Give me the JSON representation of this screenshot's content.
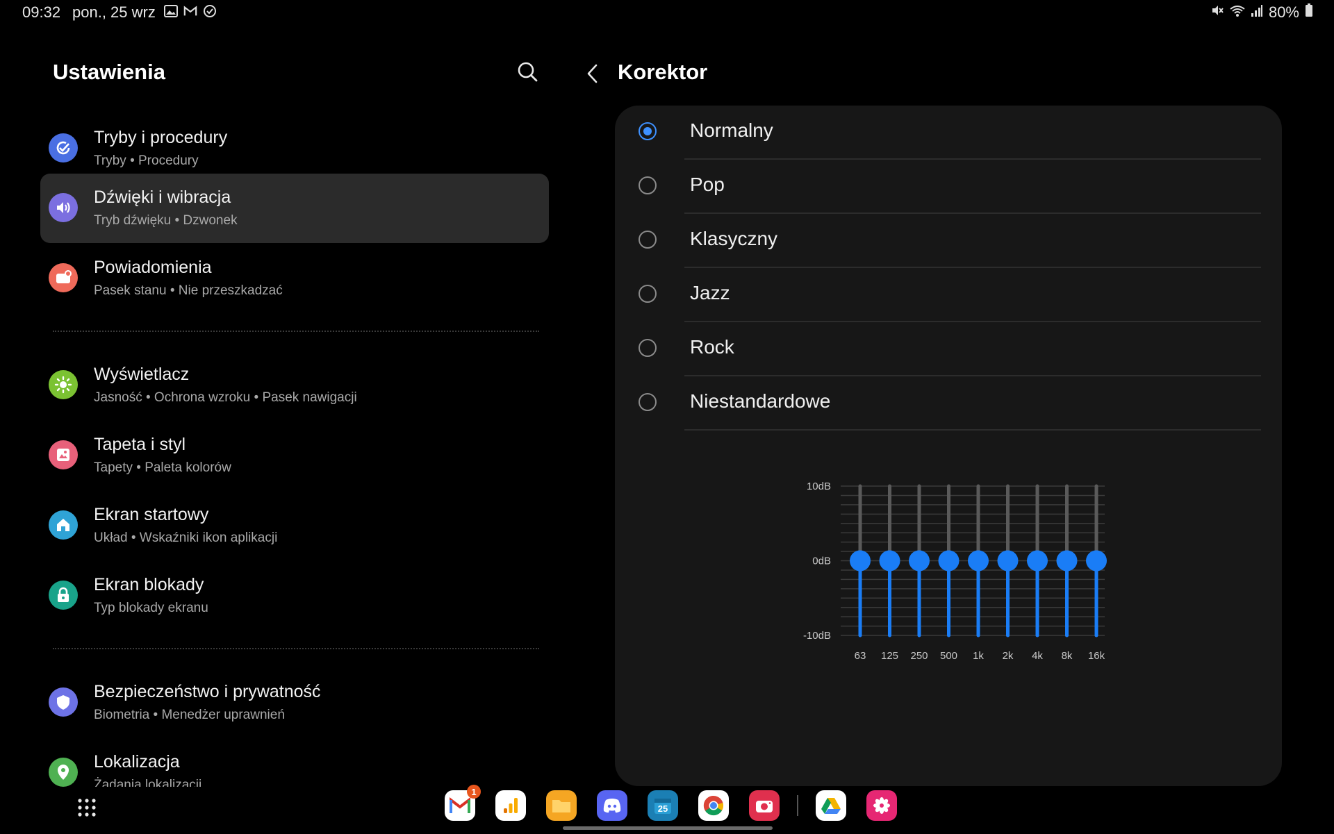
{
  "status_bar": {
    "time": "09:32",
    "date": "pon., 25 wrz",
    "notification_icons": [
      "image-icon",
      "gmail-icon",
      "sync-icon"
    ],
    "system_icons": [
      "mute-icon",
      "wifi-icon",
      "signal-icon",
      "battery-icon"
    ],
    "battery": "80%"
  },
  "settings": {
    "title": "Ustawienia",
    "items": [
      {
        "title": "Tryby i procedury",
        "subtitle": "Tryby  •  Procedury",
        "icon": "modes-icon",
        "color": "#4a6fe3"
      },
      {
        "title": "Dźwięki i wibracja",
        "subtitle": "Tryb dźwięku  •  Dzwonek",
        "icon": "sound-icon",
        "color": "#7b6fe0"
      },
      {
        "title": "Powiadomienia",
        "subtitle": "Pasek stanu  •  Nie przeszkadzać",
        "icon": "notification-icon",
        "color": "#ef6a5a"
      },
      {
        "title": "Wyświetlacz",
        "subtitle": "Jasność  •  Ochrona wzroku  •  Pasek nawigacji",
        "icon": "display-icon",
        "color": "#7bc232"
      },
      {
        "title": "Tapeta i styl",
        "subtitle": "Tapety  •  Paleta kolorów",
        "icon": "wallpaper-icon",
        "color": "#e8607a"
      },
      {
        "title": "Ekran startowy",
        "subtitle": "Układ  •  Wskaźniki ikon aplikacji",
        "icon": "home-icon",
        "color": "#2fa3d6"
      },
      {
        "title": "Ekran blokady",
        "subtitle": "Typ blokady ekranu",
        "icon": "lock-icon",
        "color": "#19a38a"
      },
      {
        "title": "Bezpieczeństwo i prywatność",
        "subtitle": "Biometria  •  Menedżer uprawnień",
        "icon": "shield-icon",
        "color": "#6d72e6"
      },
      {
        "title": "Lokalizacja",
        "subtitle": "Żądania lokalizacji",
        "icon": "location-icon",
        "color": "#4fb152"
      }
    ],
    "active_item": "Dźwięki i wibracja"
  },
  "equalizer": {
    "title": "Korektor",
    "presets": [
      "Normalny",
      "Pop",
      "Klasyczny",
      "Jazz",
      "Rock",
      "Niestandardowe"
    ],
    "selected": "Normalny",
    "accent": "#1a7df6",
    "y_labels": [
      "10dB",
      "0dB",
      "-10dB"
    ],
    "bands": [
      "63",
      "125",
      "250",
      "500",
      "1k",
      "2k",
      "4k",
      "8k",
      "16k"
    ],
    "levels_db": [
      0,
      0,
      0,
      0,
      0,
      0,
      0,
      0,
      0
    ],
    "range_db": [
      -10,
      10
    ]
  },
  "dock": {
    "apps": [
      {
        "name": "Gmail",
        "icon": "gmail-icon",
        "badge": "1"
      },
      {
        "name": "Analytics",
        "icon": "analytics-icon"
      },
      {
        "name": "Pliki",
        "icon": "folder-icon"
      },
      {
        "name": "Discord",
        "icon": "discord-icon"
      },
      {
        "name": "Kalendarz",
        "icon": "calendar-icon",
        "label": "25"
      },
      {
        "name": "Chrome",
        "icon": "chrome-icon"
      },
      {
        "name": "Aparat",
        "icon": "camera-icon"
      },
      {
        "name": "Dysk",
        "icon": "drive-icon"
      },
      {
        "name": "Bixby",
        "icon": "flower-icon"
      }
    ]
  }
}
